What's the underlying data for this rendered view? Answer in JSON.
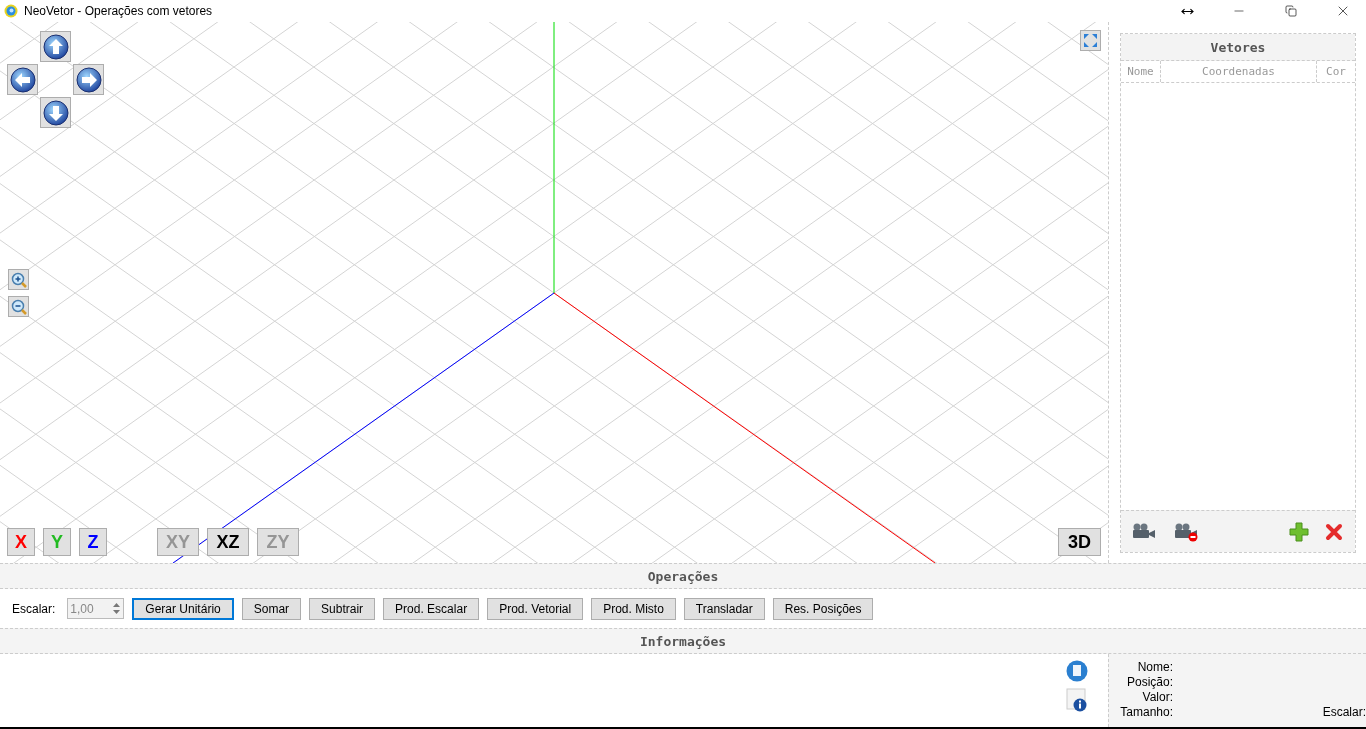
{
  "window": {
    "title": "NeoVetor - Operações com vetores"
  },
  "viewport": {
    "axis_buttons": [
      {
        "label": "X",
        "color": "#ff0000"
      },
      {
        "label": "Y",
        "color": "#22bb22"
      },
      {
        "label": "Z",
        "color": "#0000ff"
      }
    ],
    "view_buttons": [
      {
        "label": "XY",
        "selected": false
      },
      {
        "label": "XZ",
        "selected": true
      },
      {
        "label": "ZY",
        "selected": false
      }
    ],
    "mode_button": "3D"
  },
  "vectors_panel": {
    "title": "Vetores",
    "columns": [
      "Nome",
      "Coordenadas",
      "Cor"
    ]
  },
  "operations": {
    "title": "Operações",
    "scalar_label": "Escalar:",
    "scalar_value": "1,00",
    "buttons": [
      {
        "label": "Gerar Unitário",
        "focused": true
      },
      {
        "label": "Somar",
        "focused": false
      },
      {
        "label": "Subtrair",
        "focused": false
      },
      {
        "label": "Prod. Escalar",
        "focused": false
      },
      {
        "label": "Prod. Vetorial",
        "focused": false
      },
      {
        "label": "Prod. Misto",
        "focused": false
      },
      {
        "label": "Transladar",
        "focused": false
      },
      {
        "label": "Res. Posições",
        "focused": false
      }
    ]
  },
  "information": {
    "title": "Informações",
    "labels": [
      "Nome:",
      "Posição:",
      "Valor:",
      "Tamanho:"
    ],
    "scalar_label": "Escalar:"
  }
}
